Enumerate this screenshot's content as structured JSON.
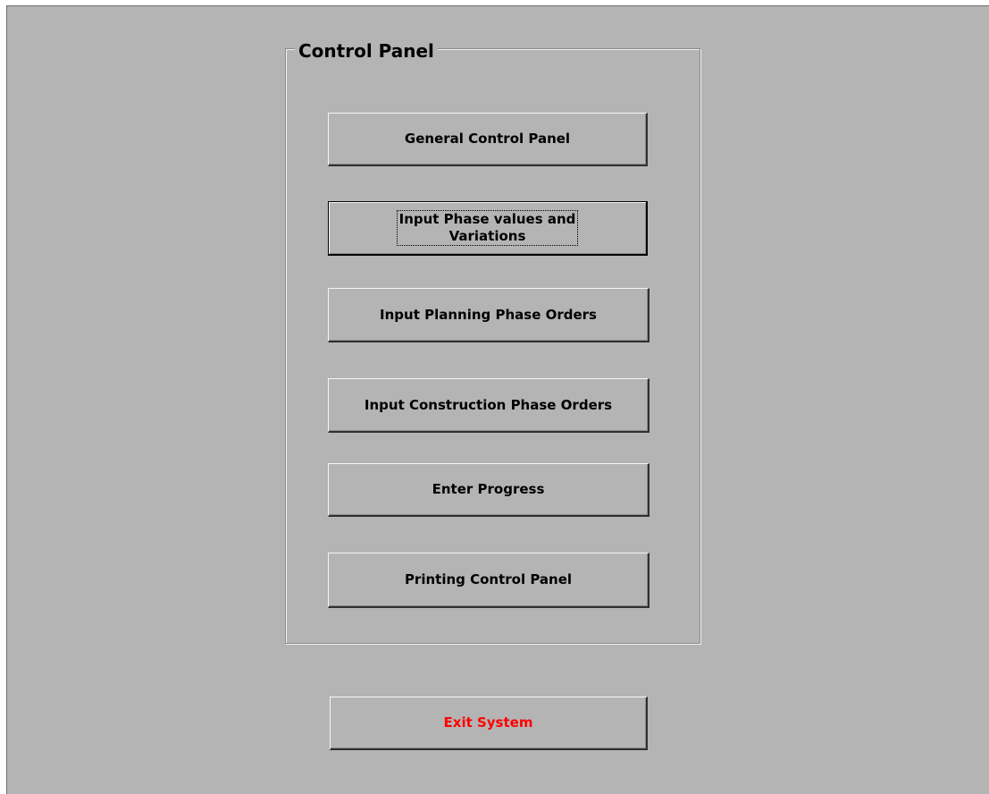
{
  "panel": {
    "title": "Control Panel",
    "buttons": [
      {
        "label": "General Control Panel"
      },
      {
        "label": "Input Phase values and Variations",
        "line1": "Input Phase values and",
        "line2": "Variations",
        "focused": true
      },
      {
        "label": "Input Planning Phase Orders"
      },
      {
        "label": "Input Construction Phase Orders"
      },
      {
        "label": "Enter Progress"
      },
      {
        "label": "Printing Control Panel"
      }
    ]
  },
  "exit": {
    "label": "Exit System",
    "color": "#ff0000"
  },
  "colors": {
    "form_background": "#b4b4b4",
    "text": "#000000"
  }
}
